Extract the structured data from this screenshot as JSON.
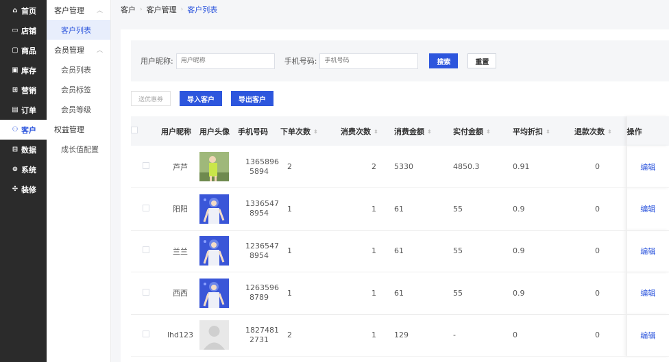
{
  "nav": {
    "items": [
      {
        "icon": "home-icon",
        "glyph": "⌂",
        "label": "首页"
      },
      {
        "icon": "store-icon",
        "glyph": "▭",
        "label": "店铺"
      },
      {
        "icon": "goods-icon",
        "glyph": "▢",
        "label": "商品"
      },
      {
        "icon": "inventory-icon",
        "glyph": "▣",
        "label": "库存"
      },
      {
        "icon": "marketing-icon",
        "glyph": "⊞",
        "label": "营销"
      },
      {
        "icon": "order-icon",
        "glyph": "▤",
        "label": "订单"
      },
      {
        "icon": "customer-icon",
        "glyph": "⚇",
        "label": "客户"
      },
      {
        "icon": "data-icon",
        "glyph": "⊟",
        "label": "数据"
      },
      {
        "icon": "system-icon",
        "glyph": "⊚",
        "label": "系统"
      },
      {
        "icon": "decorate-icon",
        "glyph": "✣",
        "label": "装修"
      }
    ],
    "active_index": 6
  },
  "submenu": {
    "group1": {
      "label": "客户管理",
      "items": [
        "客户列表"
      ]
    },
    "group2": {
      "label": "会员管理",
      "items": [
        "会员列表",
        "会员标签",
        "会员等级"
      ]
    },
    "extra": [
      "权益管理",
      "成长值配置"
    ]
  },
  "breadcrumb": [
    "客户",
    "客户管理",
    "客户列表"
  ],
  "filter": {
    "nickname_label": "用户昵称:",
    "nickname_placeholder": "用户昵称",
    "phone_label": "手机号码:",
    "phone_placeholder": "手机号码",
    "search_label": "搜索",
    "reset_label": "重置"
  },
  "actions": {
    "coupon_label": "送优惠券",
    "import_label": "导入客户",
    "export_label": "导出客户"
  },
  "table": {
    "headers": [
      "用户昵称",
      "用户头像",
      "手机号码",
      "下单次数",
      "消费次数",
      "消费金额",
      "实付金额",
      "平均折扣",
      "退款次数",
      "操作"
    ],
    "rows": [
      {
        "nickname": "芦芦",
        "avatar": "photo-green",
        "phone_a": "1365896",
        "phone_b": "5894",
        "orders": "2",
        "purchases": "2",
        "amount": "5330",
        "paid": "4850.3",
        "discount": "0.91",
        "refunds": "0",
        "op": "编辑"
      },
      {
        "nickname": "阳阳",
        "avatar": "photo-blue",
        "phone_a": "1336547",
        "phone_b": "8954",
        "orders": "1",
        "purchases": "1",
        "amount": "61",
        "paid": "55",
        "discount": "0.9",
        "refunds": "0",
        "op": "编辑"
      },
      {
        "nickname": "兰兰",
        "avatar": "photo-blue",
        "phone_a": "1236547",
        "phone_b": "8954",
        "orders": "1",
        "purchases": "1",
        "amount": "61",
        "paid": "55",
        "discount": "0.9",
        "refunds": "0",
        "op": "编辑"
      },
      {
        "nickname": "西西",
        "avatar": "photo-blue",
        "phone_a": "1263596",
        "phone_b": "8789",
        "orders": "1",
        "purchases": "1",
        "amount": "61",
        "paid": "55",
        "discount": "0.9",
        "refunds": "0",
        "op": "编辑"
      },
      {
        "nickname": "lhd123",
        "avatar": "placeholder",
        "phone_a": "1827481",
        "phone_b": "2731",
        "orders": "2",
        "purchases": "1",
        "amount": "129",
        "paid": "-",
        "discount": "0",
        "refunds": "0",
        "op": "编辑"
      }
    ]
  },
  "colors": {
    "primary": "#2d56dd",
    "nav_bg": "#2b2b2b",
    "page_bg": "#f5f6f8"
  }
}
